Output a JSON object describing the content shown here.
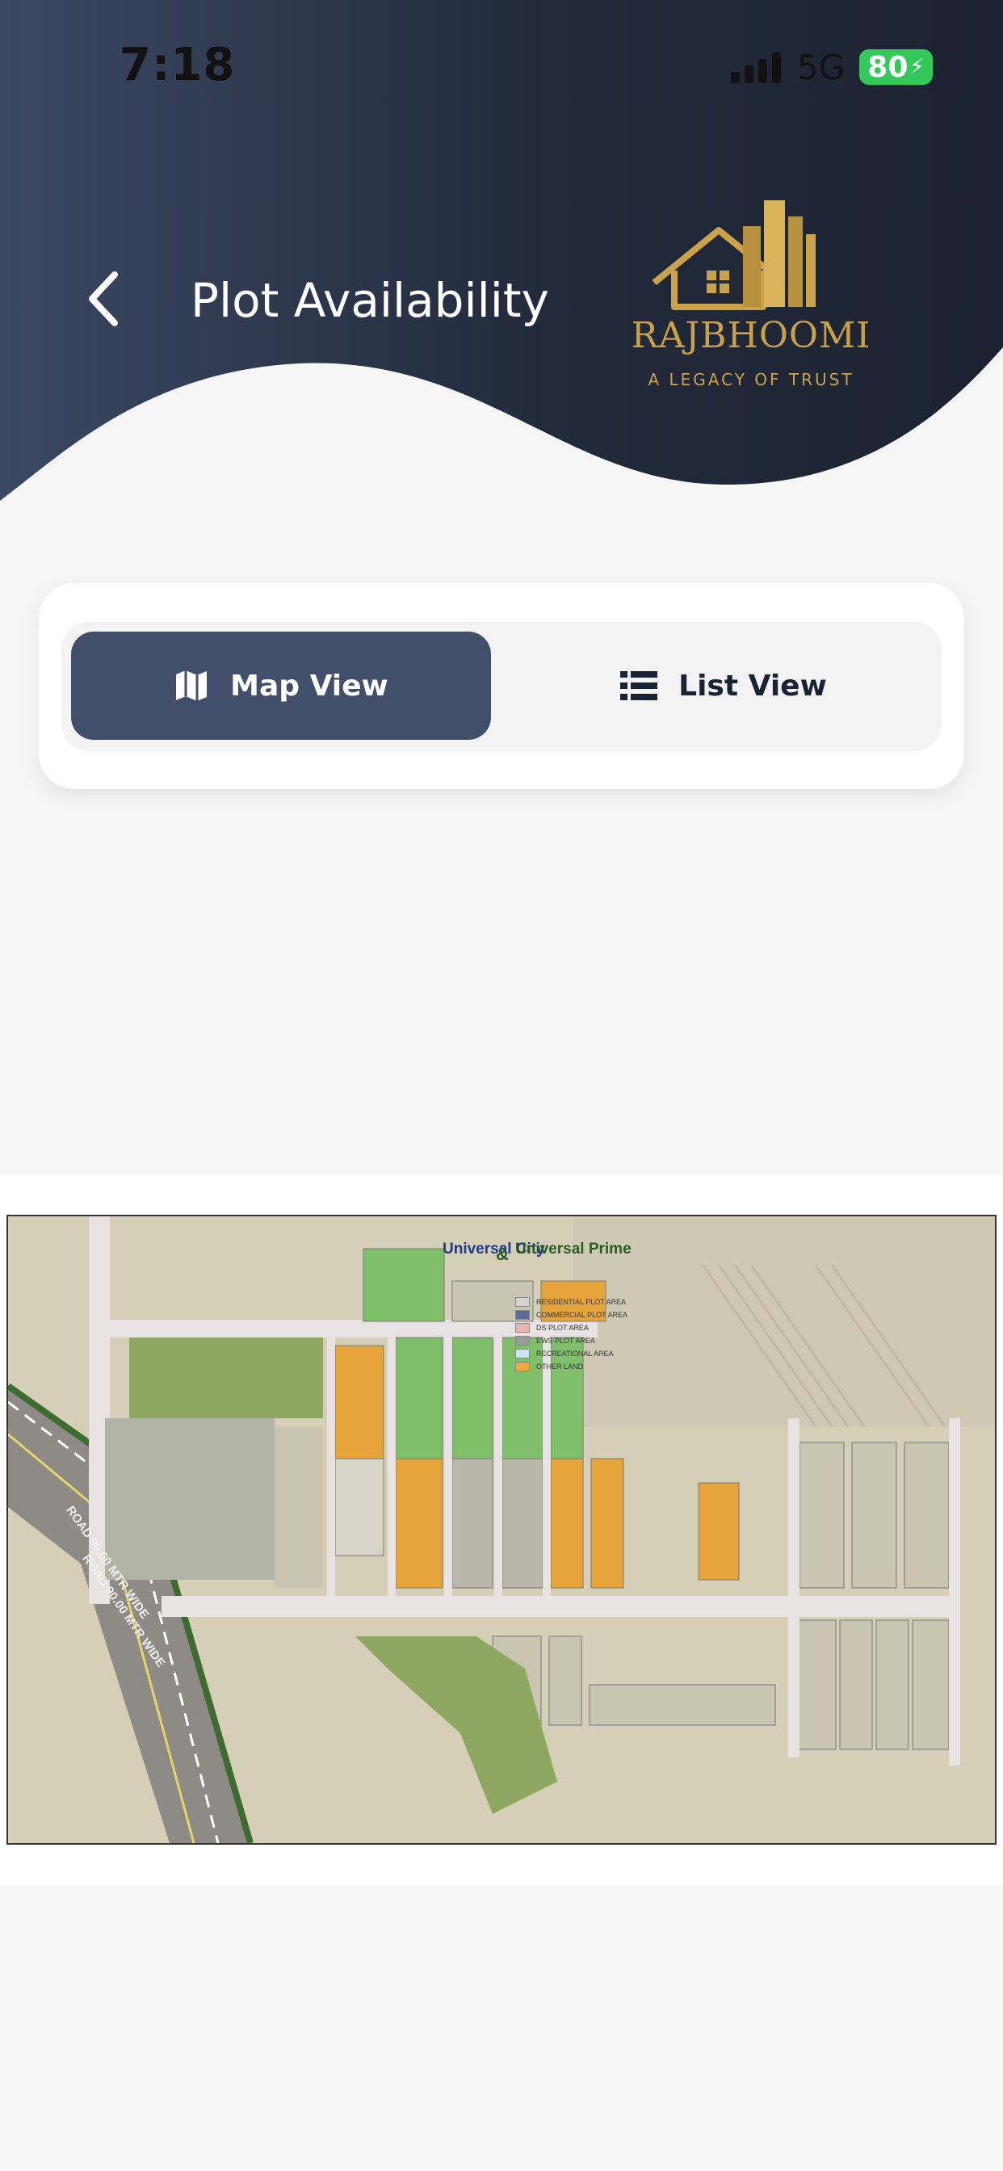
{
  "status_bar": {
    "time": "7:18",
    "network": "5G",
    "battery": "80"
  },
  "header": {
    "title": "Plot Availability",
    "back_icon": "chevron-left-icon"
  },
  "logo": {
    "name": "RAJBHOOMI",
    "tagline": "A LEGACY OF TRUST"
  },
  "view_toggle": {
    "map_label": "Map View",
    "list_label": "List View",
    "selected": "Map View"
  },
  "map": {
    "brand_left": "Universal City",
    "brand_right": "Universal Prime",
    "connector": "&",
    "legend": [
      {
        "label": "RESIDENTIAL PLOT AREA",
        "color": "#d4d4d4"
      },
      {
        "label": "COMMERCIAL PLOT AREA",
        "color": "#5b6b9a"
      },
      {
        "label": "DS PLOT AREA",
        "color": "#e8b4b4"
      },
      {
        "label": "EWS PLOT AREA",
        "color": "#9a9a9a"
      },
      {
        "label": "RECREATIONAL AREA",
        "color": "#cfe3f5"
      },
      {
        "label": "OTHER LAND",
        "color": "#f2a93b"
      }
    ],
    "road_label_1": "ROAD 90.00 MTR WIDE",
    "road_label_2": "ROAD 90.00 MTR WIDE"
  },
  "colors": {
    "header_dark": "#1f2535",
    "accent": "#424f6a",
    "gold": "#c9a24a",
    "available": "#7fbf6a",
    "booked": "#e6a53a"
  }
}
